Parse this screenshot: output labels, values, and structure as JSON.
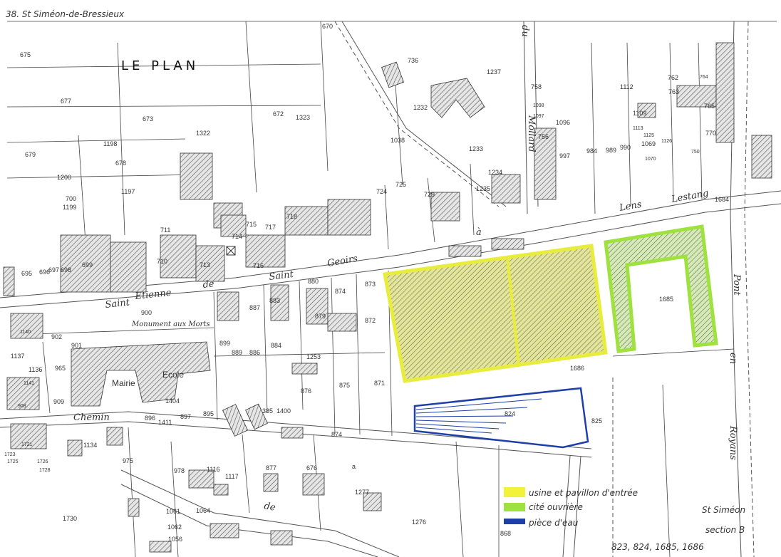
{
  "header_note": "38. St Siméon-de-Bressieux",
  "area_name": "LE PLAN",
  "streets": {
    "street_1": "Saint",
    "street_2": "Etienne",
    "street_3": "de",
    "street_4": "Saint",
    "street_5": "Geoirs",
    "street_6": "Lens",
    "street_7": "Lestang",
    "street_8": "Chemin",
    "street_9": "de",
    "street_10": "Pont",
    "street_11": "en",
    "street_12": "Royans",
    "street_13": "du",
    "street_14": "Mollard",
    "street_15": "à"
  },
  "places": {
    "monument": "Monument aux Morts",
    "mairie": "Mairie",
    "ecole": "Ecole"
  },
  "parcels": [
    "670",
    "675",
    "677",
    "673",
    "679",
    "1198",
    "1200",
    "1197",
    "700",
    "1199",
    "678",
    "1322",
    "672",
    "1323",
    "1237",
    "736",
    "1232",
    "1038",
    "1233",
    "1234",
    "1235",
    "758",
    "1098",
    "1097",
    "1096",
    "756",
    "997",
    "984",
    "989",
    "990",
    "1112",
    "762",
    "764",
    "763",
    "765",
    "1109",
    "1113",
    "1125",
    "1069",
    "1126",
    "770",
    "750",
    "1070",
    "1684",
    "1685",
    "1686",
    "825",
    "824",
    "695",
    "696",
    "697",
    "698",
    "699",
    "710",
    "711",
    "713",
    "714",
    "715",
    "716",
    "717",
    "718",
    "724",
    "725",
    "729",
    "873",
    "874",
    "872",
    "880",
    "879",
    "883",
    "887",
    "889",
    "886",
    "884",
    "899",
    "901",
    "902",
    "900",
    "1137",
    "1136",
    "965",
    "909",
    "908",
    "1253",
    "875",
    "871",
    "876",
    "1404",
    "1411",
    "895",
    "896",
    "897",
    "1400",
    "385",
    "874",
    "1134",
    "975",
    "978",
    "1116",
    "1117",
    "877",
    "676",
    "a",
    "1277",
    "1276",
    "868",
    "1061",
    "1064",
    "1062",
    "1056",
    "1730",
    "1726",
    "1725",
    "1728",
    "1721",
    "1723",
    "1141",
    "1140"
  ],
  "legend": [
    {
      "color": "#f2f23a",
      "label": "usine et pavillon d'entrée"
    },
    {
      "color": "#9fe23f",
      "label": "cité ouvrière"
    },
    {
      "color": "#1f3fa8",
      "label": "pièce d'eau"
    }
  ],
  "footer": {
    "place": "St Siméon",
    "section": "section B",
    "parcel_list": "823, 824, 1685, 1686"
  }
}
